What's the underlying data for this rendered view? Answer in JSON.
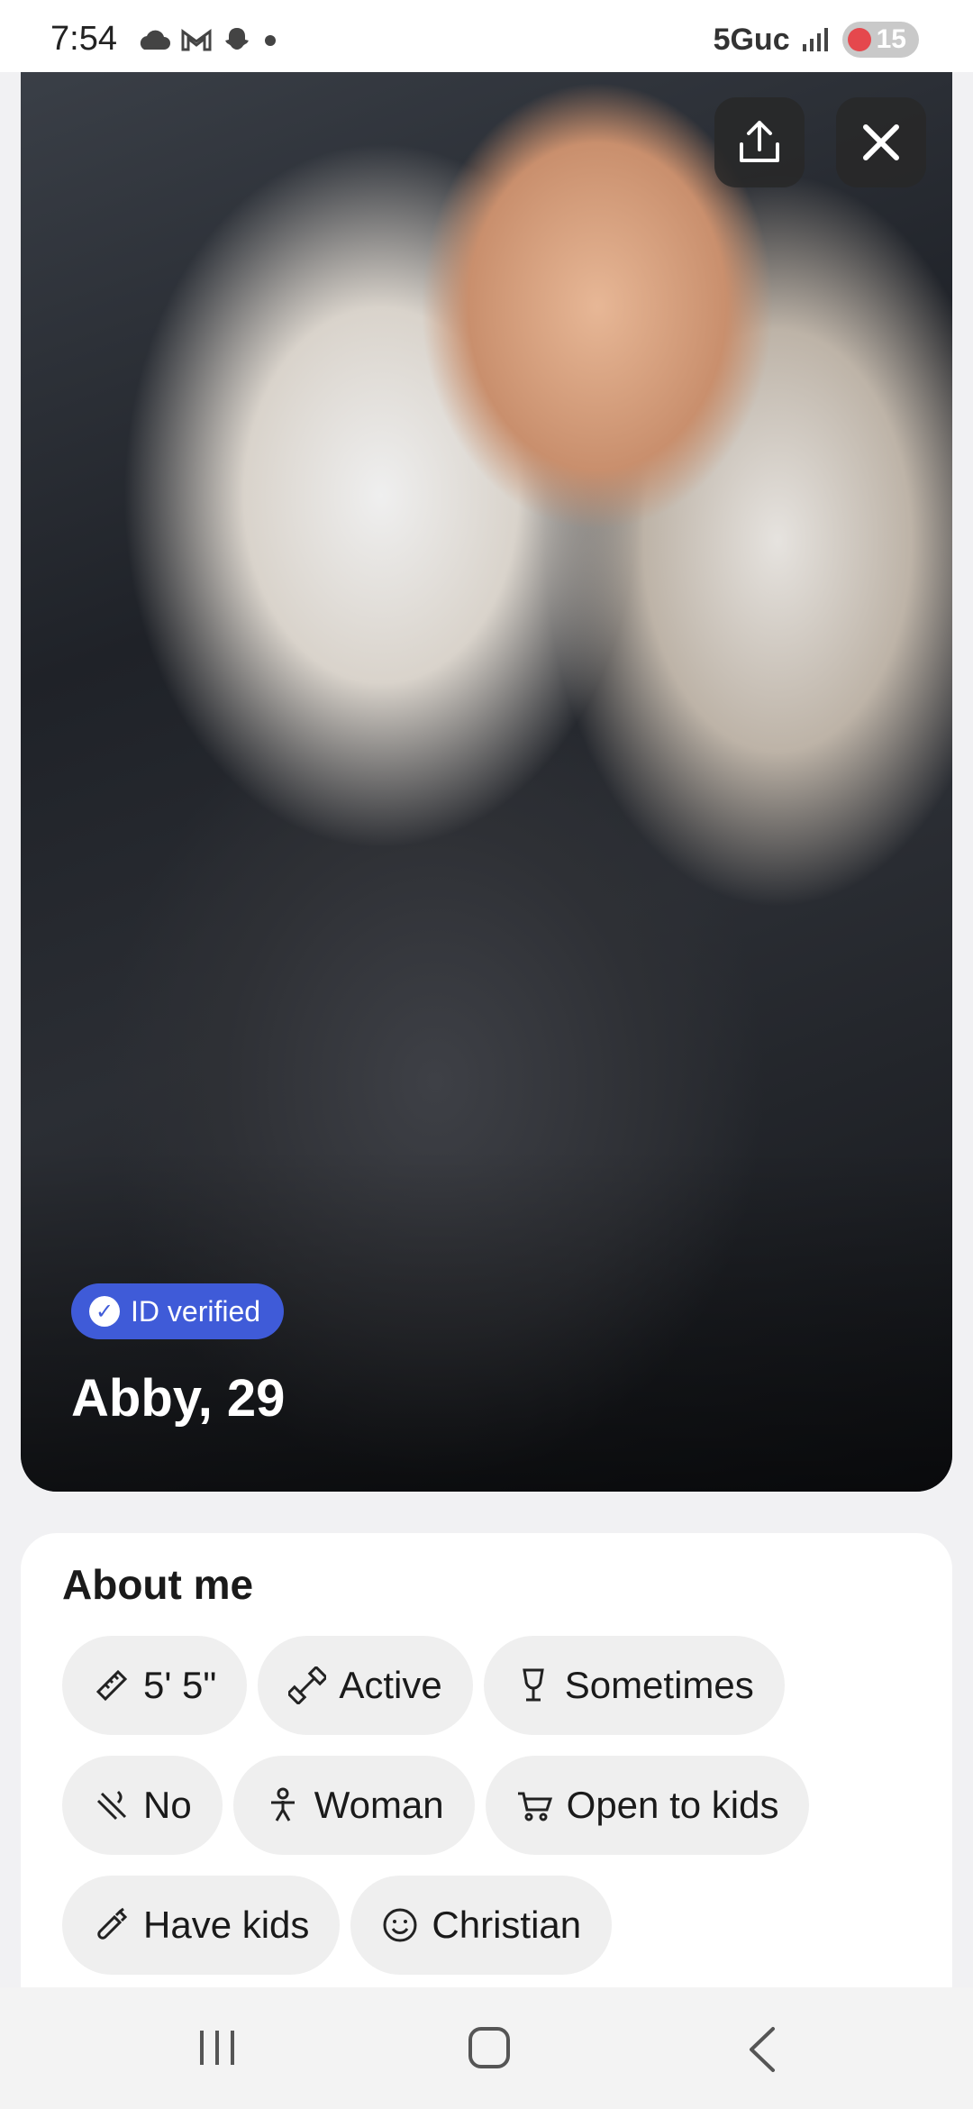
{
  "status_bar": {
    "time": "7:54",
    "network": "5Guc",
    "battery": "15",
    "icons": [
      "cloud-icon",
      "gmail-icon",
      "snapchat-icon",
      "dot-icon",
      "signal-icon"
    ]
  },
  "profile": {
    "verified_label": "ID verified",
    "name_age": "Abby, 29"
  },
  "about": {
    "title": "About me",
    "chips": [
      {
        "icon": "ruler-icon",
        "label": "5' 5\""
      },
      {
        "icon": "dumbbell-icon",
        "label": "Active"
      },
      {
        "icon": "wine-glass-icon",
        "label": "Sometimes"
      },
      {
        "icon": "no-smoking-icon",
        "label": "No"
      },
      {
        "icon": "person-icon",
        "label": "Woman"
      },
      {
        "icon": "stroller-icon",
        "label": "Open to kids"
      },
      {
        "icon": "bottle-icon",
        "label": "Have kids"
      },
      {
        "icon": "smile-icon",
        "label": "Christian"
      }
    ]
  },
  "nav": {
    "items": [
      "recents-icon",
      "home-icon",
      "back-icon"
    ]
  },
  "colors": {
    "verified_badge": "#3f5bd8",
    "chip_bg": "#efefef",
    "battery_low": "#e5484d"
  }
}
